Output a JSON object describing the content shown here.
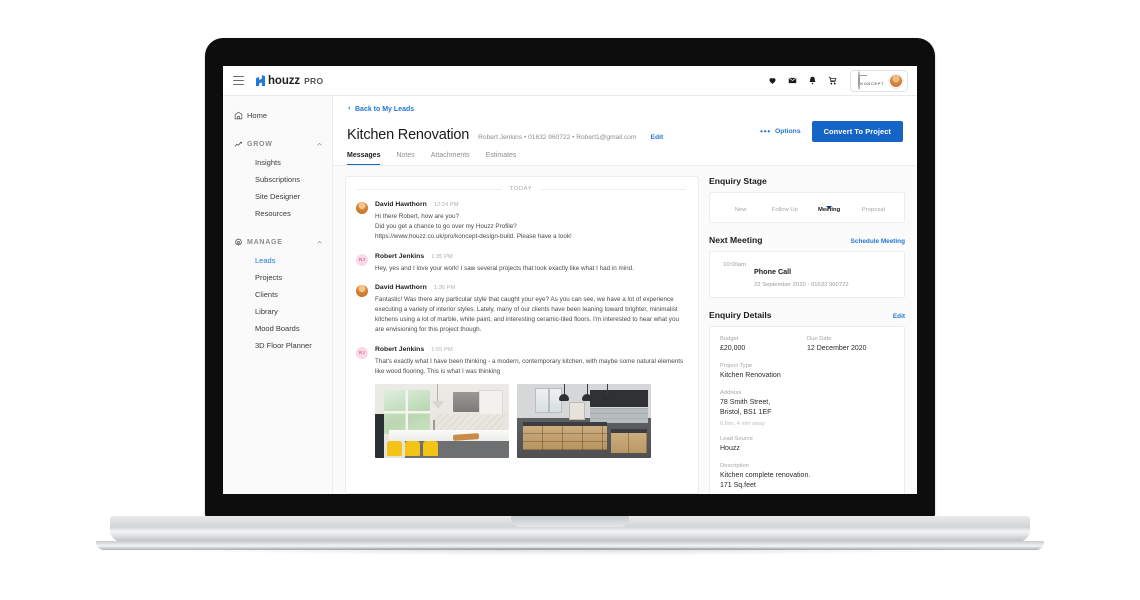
{
  "topbar": {
    "menu_icon": "hamburger-icon",
    "brand_name": "houzz",
    "brand_suffix": "PRO",
    "icons": [
      "heart-icon",
      "envelope-icon",
      "bell-icon",
      "cart-icon"
    ],
    "company_badge": "KONCEPT",
    "avatar": "user-avatar"
  },
  "sidebar": {
    "home": {
      "label": "Home",
      "icon": "home-icon"
    },
    "groups": [
      {
        "label": "GROW",
        "icon": "trend-up-icon",
        "chevron": "chevron-up-icon",
        "items": [
          {
            "label": "Insights",
            "active": false
          },
          {
            "label": "Subscriptions",
            "active": false
          },
          {
            "label": "Site Designer",
            "active": false
          },
          {
            "label": "Resources",
            "active": false
          }
        ]
      },
      {
        "label": "MANAGE",
        "icon": "gear-icon",
        "chevron": "chevron-up-icon",
        "items": [
          {
            "label": "Leads",
            "active": true
          },
          {
            "label": "Projects",
            "active": false
          },
          {
            "label": "Clients",
            "active": false
          },
          {
            "label": "Library",
            "active": false
          },
          {
            "label": "Mood Boards",
            "active": false
          },
          {
            "label": "3D Floor Planner",
            "active": false
          }
        ]
      }
    ]
  },
  "page": {
    "back_link": "Back to My Leads",
    "title": "Kitchen Renovation",
    "contact_line": "Robert Jenkins • 01632 960722 • Robert1@gmail.com",
    "edit_label": "Edit",
    "options_label": "Options",
    "convert_label": "Convert To Project",
    "tabs": [
      {
        "label": "Messages",
        "active": true
      },
      {
        "label": "Notes",
        "active": false
      },
      {
        "label": "Attachments",
        "active": false
      },
      {
        "label": "Estimates",
        "active": false
      }
    ]
  },
  "chat": {
    "day_separator": "TODAY",
    "messages": [
      {
        "author": "David Hawthorn",
        "time": "12:24 PM",
        "avatar_type": "photo",
        "initials": "",
        "lines": [
          "Hi there Robert, how are you?",
          "Did you get a chance to go over my Houzz Profile?",
          "https://www.houzz.co.uk/pro/koncept-design-build. Please have a look!"
        ]
      },
      {
        "author": "Robert Jenkins",
        "time": "1:35 PM",
        "avatar_type": "initials",
        "initials": "RJ",
        "lines": [
          "Hey, yes and I love your work! I saw several projects that look exactly like what I had in mind."
        ]
      },
      {
        "author": "David Hawthorn",
        "time": "1:36 PM",
        "avatar_type": "photo",
        "initials": "",
        "lines": [
          "Fantastic! Was there any particular style that caught your eye? As you can see, we have a lot of experience executing a variety of interior styles. Lately, many of our clients have been leaning toward brighter, minimalist kitchens using a lot of marble, white paint, and interesting ceramic-tiled floors. I'm interested to hear what you are envisioning for this project though."
        ]
      },
      {
        "author": "Robert Jenkins",
        "time": "1:55 PM",
        "avatar_type": "initials",
        "initials": "RJ",
        "lines": [
          "That's exactly what I have been thinking - a modern, contemporary kitchen, with maybe some natural elements like wood flooring. This is what I was thinking"
        ],
        "attachments": [
          {
            "name": "bright-white-kitchen-photo"
          },
          {
            "name": "oak-dark-kitchen-photo"
          }
        ]
      }
    ]
  },
  "enquiry_stage": {
    "heading": "Enquiry Stage",
    "stages": [
      {
        "label": "New",
        "active": false
      },
      {
        "label": "Follow Up",
        "active": false
      },
      {
        "label": "Meeting",
        "active": true
      },
      {
        "label": "Proposal",
        "active": false
      }
    ],
    "active_color": "#1A4C8C",
    "inactive_color": "#DCE8F5"
  },
  "next_meeting": {
    "heading": "Next Meeting",
    "action_label": "Schedule Meeting",
    "time": "10:00am",
    "title": "Phone Call",
    "subtitle": "22 September 2020 - 01632 960722"
  },
  "enquiry_details": {
    "heading": "Enquiry Details",
    "edit_label": "Edit",
    "budget_label": "Budget",
    "budget_value": "£20,000",
    "due_date_label": "Due Date",
    "due_date_value": "12 December 2020",
    "project_type_label": "Project Type",
    "project_type_value": "Kitchen Renovation",
    "address_label": "Address",
    "address_line1": "78 Smith Street,",
    "address_line2": "Bristol, BS1 1EF",
    "address_note": "0.8mi, 4 min away",
    "lead_source_label": "Lead Source",
    "lead_source_value": "Houzz",
    "description_label": "Description",
    "description_line1": "Kitchen complete renovation.",
    "description_line2": "171 Sq.feet"
  }
}
